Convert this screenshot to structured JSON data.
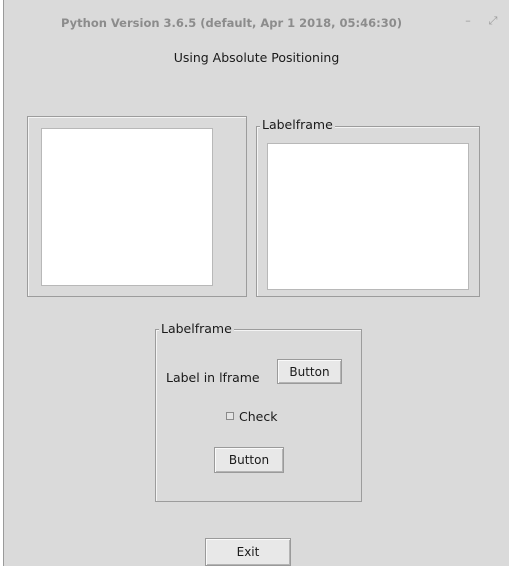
{
  "window": {
    "title": "Python Version 3.6.5 (default, Apr  1 2018, 05:46:30)",
    "minimize_glyph": "–",
    "maximize_glyph": "⤢"
  },
  "main": {
    "heading": "Using Absolute Positioning",
    "top_right_labelframe": {
      "title": "Labelframe"
    },
    "bottom_labelframe": {
      "title": "Labelframe",
      "label": "Label in lframe",
      "row_button": "Button",
      "checkbox_label": "Check",
      "checkbox_checked": false,
      "bottom_button": "Button"
    },
    "exit_button": "Exit"
  }
}
